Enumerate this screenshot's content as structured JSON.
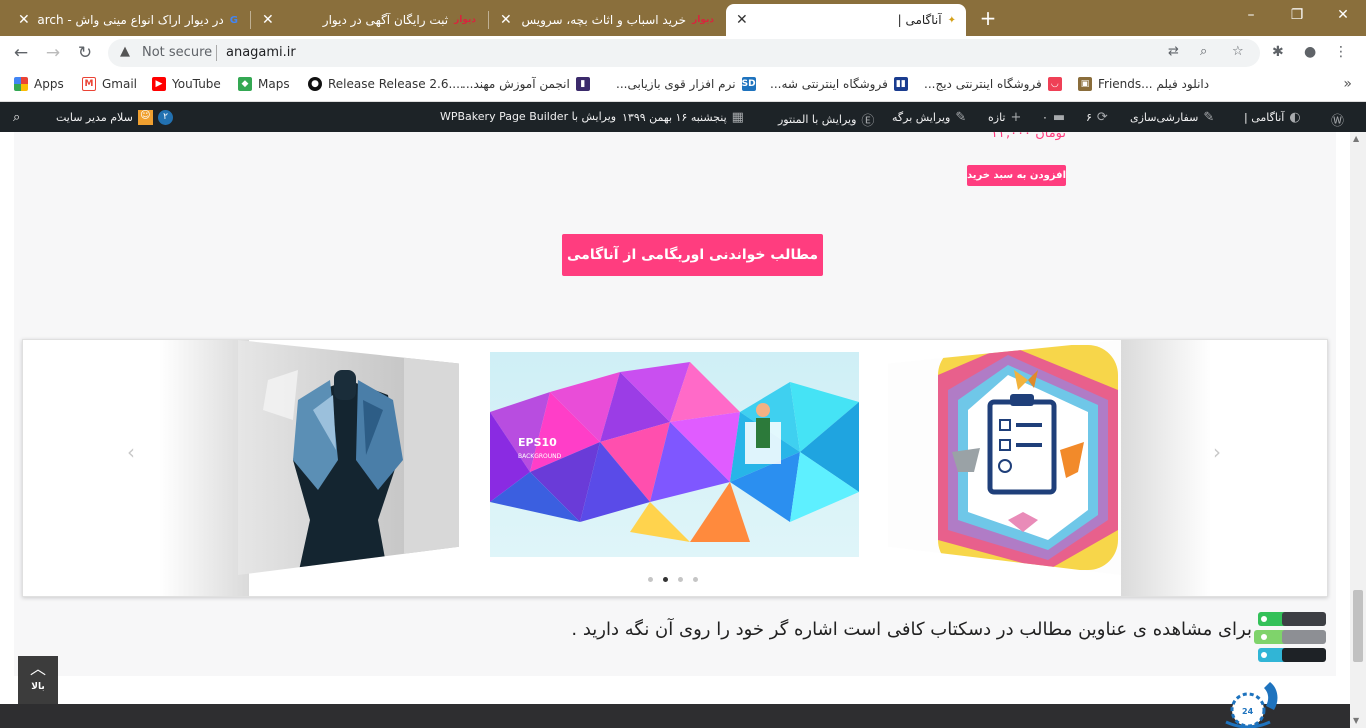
{
  "browser": {
    "tabs": [
      {
        "title": "در دیوار اراک انواع مینی واش - Search",
        "favicon": "G"
      },
      {
        "title": "ثبت رایگان آگهی در دیوار",
        "favicon": "divar"
      },
      {
        "title": "خرید اسباب و اثاث بچه، سرویس خواب",
        "favicon": "divar"
      },
      {
        "title": "آناگامی |",
        "favicon": "anagami"
      }
    ],
    "new_tab": "+",
    "window_controls": [
      "–",
      "❐",
      "✕"
    ],
    "not_secure": "Not secure",
    "url": "anagami.ir"
  },
  "bookmarks": [
    {
      "label": "Apps",
      "icon": "apps-grid-icon",
      "color": "#ea4335"
    },
    {
      "label": "Gmail",
      "icon": "gmail-icon",
      "color": "#ea4335"
    },
    {
      "label": "YouTube",
      "icon": "youtube-icon",
      "color": "#ff0000"
    },
    {
      "label": "Maps",
      "icon": "maps-icon",
      "color": "#34a853"
    },
    {
      "label": "Release Release 2.6....",
      "icon": "github-icon",
      "color": "#111111"
    },
    {
      "label": "انجمن آموزش مهند...",
      "icon": "forum-icon",
      "color": "#3b2a6b"
    },
    {
      "label": "نرم افزار قوی بازیابی...",
      "icon": "sd-icon",
      "color": "#1e73be"
    },
    {
      "label": "فروشگاه اینترنتی شه...",
      "icon": "bars-icon",
      "color": "#1a3c8f"
    },
    {
      "label": "فروشگاه اینترنتی دیج...",
      "icon": "digikala-icon",
      "color": "#ef4056"
    },
    {
      "label": "Friends... دانلود فیلم",
      "icon": "film-icon",
      "color": "#8a6d3b"
    }
  ],
  "bookmarks_more": "»",
  "wpbar": {
    "site": "آناگامی |",
    "customize": "سفارشی‌سازی",
    "updates": "۶",
    "comments": "۰",
    "new": "تازه",
    "edit_page": "ویرایش برگه",
    "edit_elementor": "ویرایش با المنتور",
    "date": "پنجشنبه ۱۶ بهمن ۱۳۹۹",
    "edit_wpbakery": "ویرایش با WPBakery Page Builder",
    "greeting": "سلام مدیر سایت",
    "badge": "۲"
  },
  "product": {
    "price": "۲۲,۰۰۰ تومان",
    "add_to_cart": "افزودن به سبد خرید"
  },
  "cta": "مطالب خواندنی اوریگامی از آناگامی",
  "carousel": {
    "center_text_1": "EPS10",
    "center_text_2": "BACKGROUND",
    "prev": "‹",
    "next": "›",
    "dots": 4,
    "active_dot": 1
  },
  "hint": "برای مشاهده ی عناوین مطالب در دسکتاب کافی است اشاره گر خود را روی آن نگه دارید .",
  "back_to_top": "بالا",
  "support_label": "24",
  "colors": {
    "accent": "#ff3d7f",
    "tabbar": "#8a6f3c",
    "wpbar": "#1d2327"
  }
}
